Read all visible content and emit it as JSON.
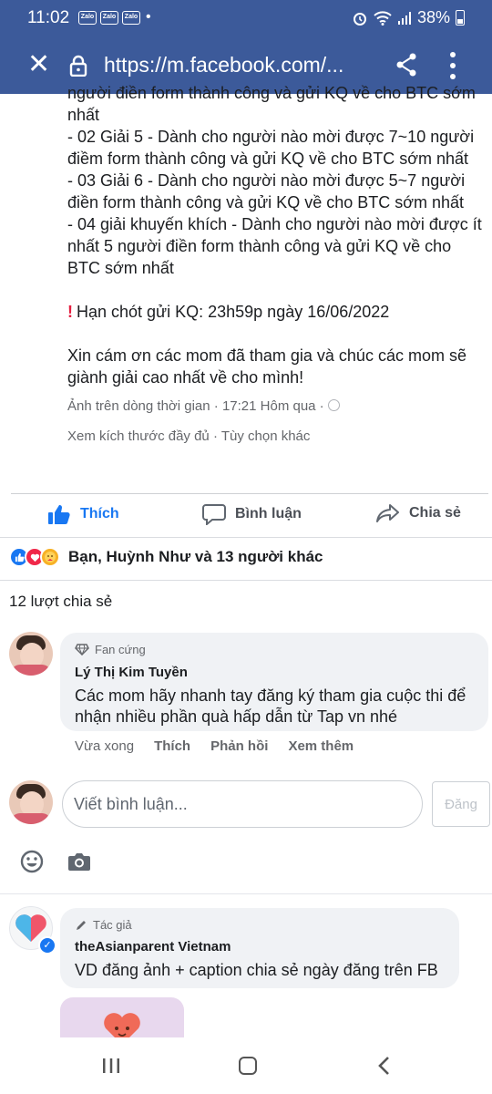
{
  "status": {
    "time": "11:02",
    "notif": [
      "Zalo",
      "Zalo",
      "Zalo"
    ],
    "dot": "•",
    "battery": "38%"
  },
  "browser": {
    "url": "https://m.facebook.com/..."
  },
  "post": {
    "lines": [
      "người điền form thành công và gửi KQ về cho BTC sớm",
      "nhất",
      "- 02 Giải 5 - Dành cho người nào mời được 7~10 người",
      "điềm form thành công và gửi KQ về cho BTC sớm nhất",
      "- 03 Giải 6 - Dành cho người nào mời được 5~7 người",
      "điền form thành công và gửi KQ về cho BTC sớm nhất",
      "- 04 giải khuyến khích - Dành cho người nào mời được ít",
      "nhất 5 người điền form thành công và gửi KQ về cho",
      "BTC sớm nhất"
    ],
    "deadline_icon": "!",
    "deadline": "Hạn chót gửi KQ: 23h59p ngày 16/06/2022",
    "thanks_lines": [
      "Xin cám ơn các mom đã tham gia và chúc các mom sẽ",
      "giành giải cao nhất về cho mình!"
    ],
    "meta": "Ảnh trên dòng thời gian · 17:21 Hôm qua ·",
    "links": "Xem kích thước đầy đủ · Tùy chọn khác"
  },
  "actions": {
    "like": "Thích",
    "comment": "Bình luận",
    "share": "Chia sẻ"
  },
  "reactions": {
    "summary": "Bạn, Huỳnh Như và 13 người khác",
    "shares": "12 lượt chia sẻ"
  },
  "comments": [
    {
      "badge": "Fan cứng",
      "name": "Lý Thị Kim Tuyền",
      "text": "Các mom hãy nhanh tay đăng ký tham gia cuộc thi để nhận nhiều phần quà hấp dẫn từ Tap vn nhé",
      "time": "Vừa xong",
      "like": "Thích",
      "reply": "Phản hồi",
      "more": "Xem thêm"
    },
    {
      "badge": "Tác giả",
      "name": "theAsianparent Vietnam",
      "text": "VD đăng ảnh + caption chia sẻ ngày đăng trên FB"
    }
  ],
  "composer": {
    "placeholder": "Viết bình luận...",
    "post": "Đăng"
  },
  "colors": {
    "header": "#3c5a9a",
    "accent": "#1877f2",
    "muted": "#65676b"
  }
}
